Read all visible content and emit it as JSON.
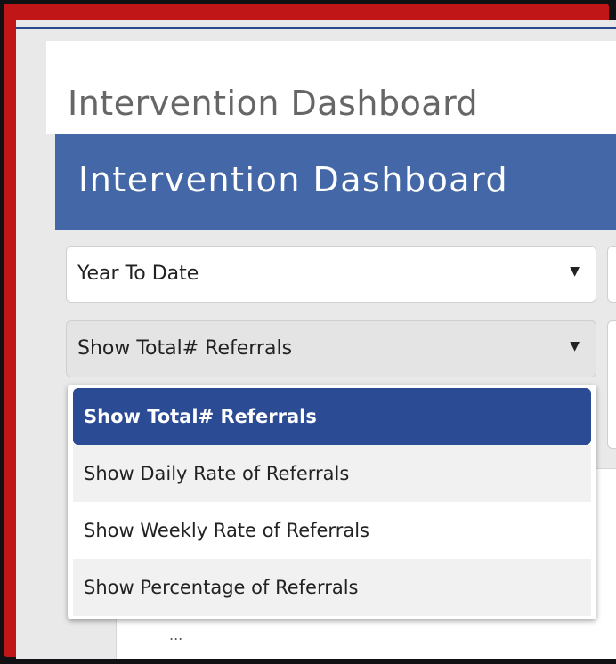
{
  "page": {
    "title": "Intervention Dashboard"
  },
  "banner": {
    "title": "Intervention Dashboard"
  },
  "filters": {
    "period": {
      "selected": "Year To Date",
      "caret": "▼"
    },
    "metric": {
      "selected": "Show Total# Referrals",
      "caret": "▼"
    }
  },
  "dropdown": {
    "options": [
      {
        "label": "Show Total# Referrals",
        "selected": true
      },
      {
        "label": "Show Daily Rate of Referrals"
      },
      {
        "label": "Show Weekly Rate of Referrals"
      },
      {
        "label": "Show Percentage of Referrals"
      }
    ]
  },
  "background_peek": {
    "text": "..."
  },
  "colors": {
    "frame": "#c01618",
    "banner": "#4468a7",
    "selected_option": "#2b4b94"
  }
}
